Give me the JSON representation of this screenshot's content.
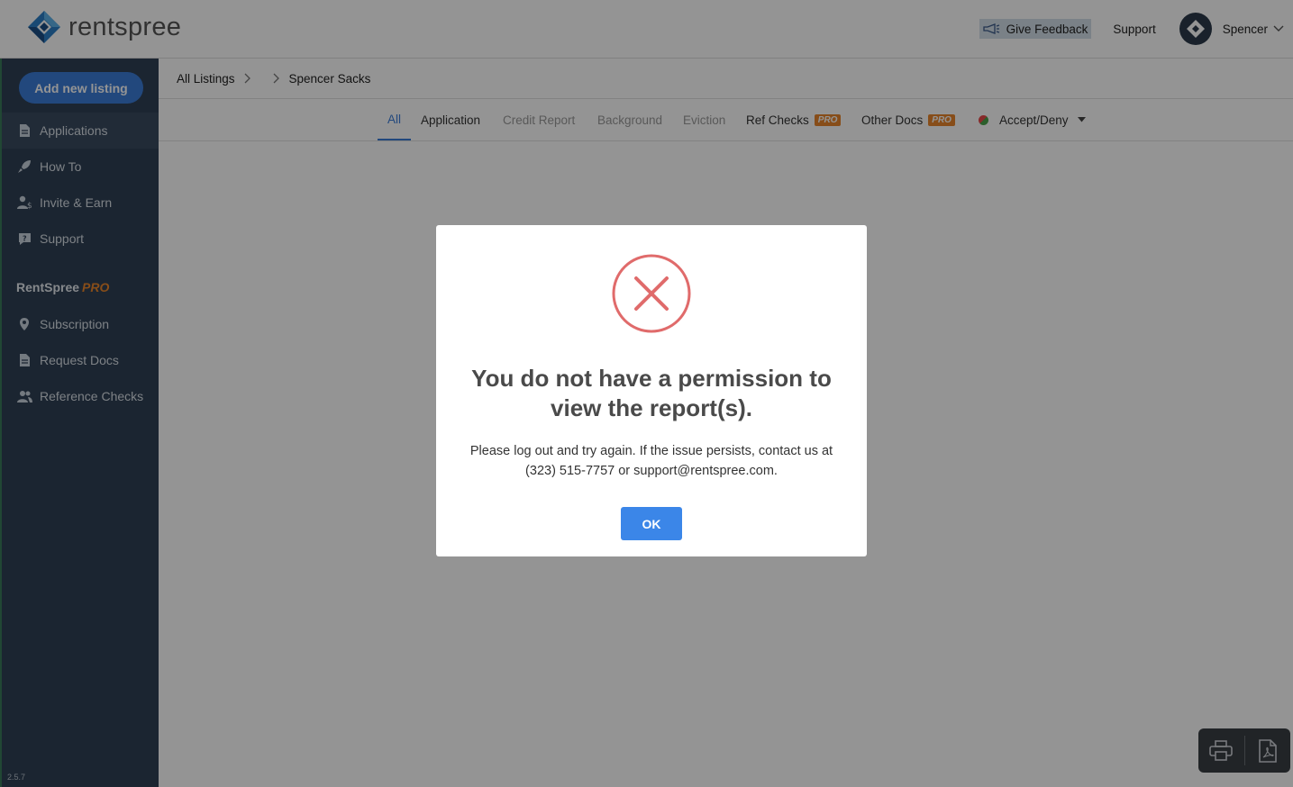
{
  "header": {
    "logo_text": "rentspree",
    "give_feedback": "Give Feedback",
    "support": "Support",
    "user_name": "Spencer"
  },
  "sidebar": {
    "add_listing": "Add new listing",
    "items": [
      {
        "label": "Applications",
        "icon": "document-icon"
      },
      {
        "label": "How To",
        "icon": "rocket-icon"
      },
      {
        "label": "Invite & Earn",
        "icon": "user-dollar-icon"
      },
      {
        "label": "Support",
        "icon": "help-chat-icon"
      }
    ],
    "pro_section": {
      "title": "RentSpree",
      "pro": "PRO"
    },
    "pro_items": [
      {
        "label": "Subscription",
        "icon": "location-pin-icon"
      },
      {
        "label": "Request Docs",
        "icon": "document-icon"
      },
      {
        "label": "Reference Checks",
        "icon": "users-icon"
      }
    ],
    "version": "2.5.7"
  },
  "breadcrumb": {
    "items": [
      "All Listings",
      "",
      "Spencer Sacks"
    ]
  },
  "tabs": [
    {
      "label": "All",
      "state": "active"
    },
    {
      "label": "Application",
      "state": "normal"
    },
    {
      "label": "Credit Report",
      "state": "muted"
    },
    {
      "label": "Background",
      "state": "muted"
    },
    {
      "label": "Eviction",
      "state": "muted"
    },
    {
      "label": "Ref Checks",
      "state": "normal",
      "badge": "PRO"
    },
    {
      "label": "Other Docs",
      "state": "normal",
      "badge": "PRO"
    },
    {
      "label": "Accept/Deny",
      "state": "normal"
    }
  ],
  "modal": {
    "title": "You do not have a permission to view the report(s).",
    "body": "Please log out and try again. If the issue persists, contact us at (323) 515-7757 or support@rentspree.com.",
    "ok": "OK"
  },
  "colors": {
    "primary": "#3b7dd8",
    "sidebar_bg": "#2f4055",
    "pro_orange": "#e8862b",
    "error_red": "#e05a5a"
  }
}
